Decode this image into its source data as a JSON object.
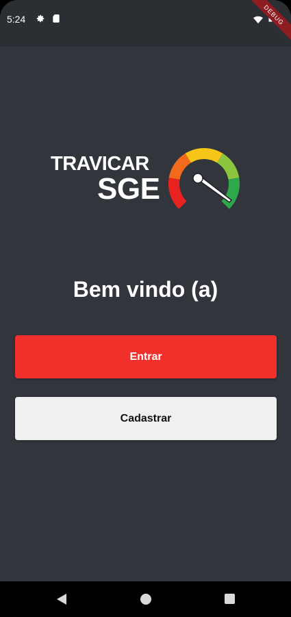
{
  "status_bar": {
    "time": "5:24",
    "icons": [
      "gear-icon",
      "sd-card-icon",
      "wifi-icon",
      "battery-icon"
    ]
  },
  "debug_banner": "DEBUG",
  "logo": {
    "line1": "TRAVICAR",
    "line2": "SGE",
    "icon": "speedometer-gauge-icon",
    "colors": [
      "#e8231f",
      "#f26a1b",
      "#f5c518",
      "#8cc63f",
      "#2ea84a"
    ]
  },
  "welcome_text": "Bem vindo (a)",
  "buttons": {
    "login_label": "Entrar",
    "register_label": "Cadastrar"
  },
  "nav_bar": {
    "icons": [
      "back-icon",
      "home-icon",
      "recents-icon"
    ]
  },
  "colors": {
    "background": "#32363c",
    "primary": "#f2302b",
    "secondary": "#f0f0f0"
  }
}
